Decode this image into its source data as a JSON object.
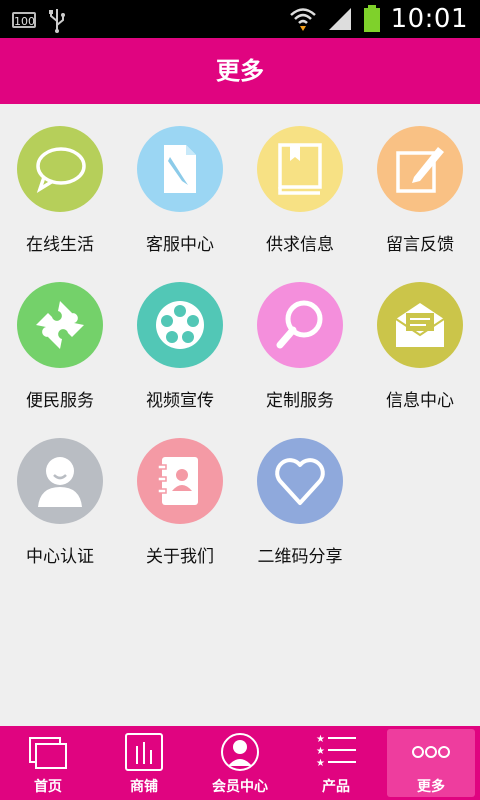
{
  "status_bar": {
    "battery_level_text": "100",
    "time": "10:01"
  },
  "header": {
    "title": "更多"
  },
  "grid": {
    "items": [
      {
        "label": "在线生活",
        "icon": "chat-bubble-icon",
        "color": "#b6cf5a"
      },
      {
        "label": "客服中心",
        "icon": "document-edit-icon",
        "color": "#9bd6f3"
      },
      {
        "label": "供求信息",
        "icon": "book-icon",
        "color": "#f7e184"
      },
      {
        "label": "留言反馈",
        "icon": "note-pencil-icon",
        "color": "#f9c184"
      },
      {
        "label": "便民服务",
        "icon": "puzzle-icon",
        "color": "#74d16a"
      },
      {
        "label": "视频宣传",
        "icon": "film-reel-icon",
        "color": "#52c7b6"
      },
      {
        "label": "定制服务",
        "icon": "magnifier-icon",
        "color": "#f48fdc"
      },
      {
        "label": "信息中心",
        "icon": "envelope-icon",
        "color": "#cbc54a"
      },
      {
        "label": "中心认证",
        "icon": "user-avatar-icon",
        "color": "#b9bdc3"
      },
      {
        "label": "关于我们",
        "icon": "contacts-book-icon",
        "color": "#f49aa5"
      },
      {
        "label": "二维码分享",
        "icon": "heart-icon",
        "color": "#8fa9dc"
      }
    ]
  },
  "tabbar": {
    "tabs": [
      {
        "label": "首页",
        "icon": "home-pages-icon"
      },
      {
        "label": "商铺",
        "icon": "store-bars-icon"
      },
      {
        "label": "会员中心",
        "icon": "member-avatar-icon"
      },
      {
        "label": "产品",
        "icon": "star-list-icon"
      },
      {
        "label": "更多",
        "icon": "more-dots-icon",
        "active": true
      }
    ]
  },
  "colors": {
    "brand": "#e00480",
    "active_tab": "#ee3d9e",
    "background": "#efefef"
  }
}
